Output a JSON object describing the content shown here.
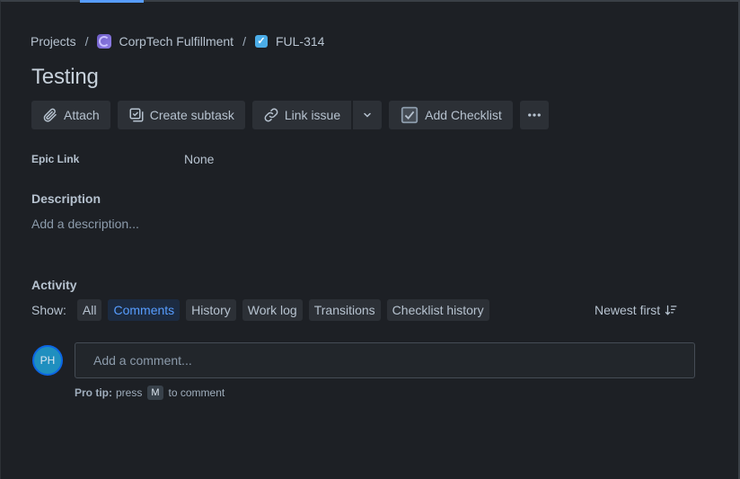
{
  "breadcrumb": {
    "projects": "Projects",
    "separator": "/",
    "project_name": "CorpTech Fulfillment",
    "issue_key": "FUL-314"
  },
  "issue": {
    "title": "Testing"
  },
  "toolbar": {
    "attach": "Attach",
    "create_subtask": "Create subtask",
    "link_issue": "Link issue",
    "add_checklist": "Add Checklist"
  },
  "fields": {
    "epic_link_label": "Epic Link",
    "epic_link_value": "None"
  },
  "description": {
    "title": "Description",
    "placeholder": "Add a description..."
  },
  "activity": {
    "title": "Activity",
    "show_label": "Show:",
    "filters": [
      "All",
      "Comments",
      "History",
      "Work log",
      "Transitions",
      "Checklist history"
    ],
    "active_filter": "Comments",
    "sort_label": "Newest first"
  },
  "comment": {
    "avatar_initials": "PH",
    "placeholder": "Add a comment...",
    "protip_label": "Pro tip:",
    "protip_text_before": "press",
    "protip_key": "M",
    "protip_text_after": "to comment"
  },
  "colors": {
    "background": "#1d2025",
    "accent": "#579dff",
    "active_chip_bg": "#1c2b41",
    "avatar_bg": "#1f8fbf"
  }
}
